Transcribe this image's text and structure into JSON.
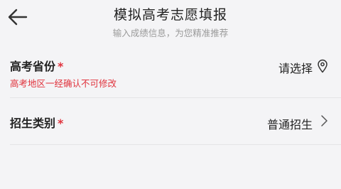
{
  "header": {
    "back_icon": "arrow-left-icon",
    "title": "模拟高考志愿填报",
    "subtitle": "输入成绩信息，为您精准推荐"
  },
  "form": {
    "province": {
      "label": "高考省份",
      "required_mark": "*",
      "value": "请选择",
      "hint": "高考地区一经确认不可修改",
      "icon": "location-pin-icon"
    },
    "category": {
      "label": "招生类别",
      "required_mark": "*",
      "value": "普通招生",
      "icon": "chevron-right-icon"
    }
  },
  "colors": {
    "background": "#f4f4f6",
    "required": "#e0323c",
    "text": "#222222",
    "subtext": "#9a9a9a"
  }
}
